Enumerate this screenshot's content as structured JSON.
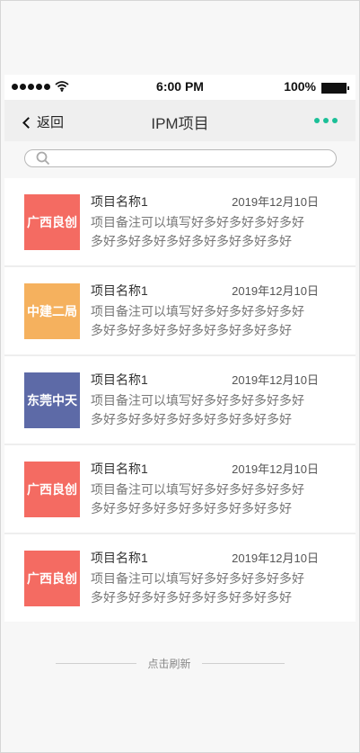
{
  "status_bar": {
    "time": "6:00 PM",
    "battery": "100%"
  },
  "nav": {
    "back_label": "返回",
    "title": "IPM项目"
  },
  "search": {
    "placeholder": ""
  },
  "items": [
    {
      "logo_text": "广西良创",
      "logo_color": "#f46b62",
      "name": "项目名称1",
      "date": "2019年12月10日",
      "desc": "项目备注可以填写好多好多好多好多好多好多好多好多好多好多好多好多好多..."
    },
    {
      "logo_text": "中建二局",
      "logo_color": "#f5b15e",
      "name": "项目名称1",
      "date": "2019年12月10日",
      "desc": "项目备注可以填写好多好多好多好多好多好多好多好多好多好多好多好多好多..."
    },
    {
      "logo_text": "东莞中天",
      "logo_color": "#5d6aa7",
      "name": "项目名称1",
      "date": "2019年12月10日",
      "desc": "项目备注可以填写好多好多好多好多好多好多好多好多好多好多好多好多好多..."
    },
    {
      "logo_text": "广西良创",
      "logo_color": "#f46b62",
      "name": "项目名称1",
      "date": "2019年12月10日",
      "desc": "项目备注可以填写好多好多好多好多好多好多好多好多好多好多好多好多好多..."
    },
    {
      "logo_text": "广西良创",
      "logo_color": "#f46b62",
      "name": "项目名称1",
      "date": "2019年12月10日",
      "desc": "项目备注可以填写好多好多好多好多好多好多好多好多好多好多好多好多好多..."
    }
  ],
  "footer": {
    "refresh_label": "点击刷新"
  },
  "colors": {
    "accent": "#1bbf97"
  }
}
